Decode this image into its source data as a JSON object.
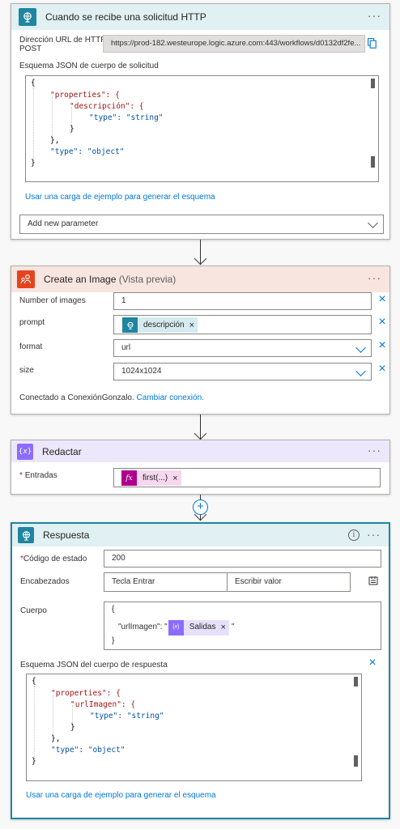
{
  "card1": {
    "title": "Cuando se recibe una solicitud HTTP",
    "more": "···",
    "url_label_1": "Dirección URL de HTTP",
    "url_label_2": "POST",
    "url_value": "https://prod-182.westeurope.logic.azure.com:443/workflows/d0132df2fe...",
    "schema_label": "Esquema JSON de cuerpo de solicitud",
    "schema_lines": [
      "{",
      "\"properties\": {",
      "\"descripción\": {",
      "\"type\": \"string\"",
      "}",
      "},",
      "\"type\": \"object\"",
      "}"
    ],
    "sample_link": "Usar una carga de ejemplo para generar el esquema",
    "add_param": "Add new parameter"
  },
  "card2": {
    "title": "Create an Image",
    "title_sub": "(Vista previa)",
    "more": "···",
    "fields": [
      {
        "label": "Number of images",
        "value": "1"
      },
      {
        "label": "prompt",
        "token": "descripción"
      },
      {
        "label": "format",
        "value": "url"
      },
      {
        "label": "size",
        "value": "1024x1024"
      }
    ],
    "connection_text": "Conectado a ConexiónGonzalo.",
    "connection_link": "Cambiar conexión."
  },
  "card3": {
    "title": "Redactar",
    "more": "···",
    "inputs_label": "Entradas",
    "token": "first(...)",
    "token_icon": "fx"
  },
  "card4": {
    "title": "Respuesta",
    "more": "···",
    "info": "i",
    "status_label": "Código de estado",
    "status_value": "200",
    "headers_label": "Encabezados",
    "header_key_placeholder": "Tecla Entrar",
    "header_value_placeholder": "Escribir valor",
    "body_label": "Cuerpo",
    "body_open": "{",
    "body_key": "\"urlImagen\": \"",
    "body_token": "Salidas",
    "body_end_quote": "\"",
    "body_close": "}",
    "schema_label": "Esquema JSON del cuerpo de respuesta",
    "schema_lines": [
      "{",
      "\"properties\": {",
      "\"urlImagen\": {",
      "\"type\": \"string\"",
      "}",
      "},",
      "\"type\": \"object\"",
      "}"
    ],
    "sample_link": "Usar una carga de ejemplo para generar el esquema"
  },
  "remove_icon": "×",
  "colors": {
    "http_teal": "#1f85a0",
    "openai_red": "#e5441e",
    "openai_header": "#f9e5e0",
    "compose_purple": "#8c6cff",
    "compose_header": "#ece7fb",
    "http_header": "#e0f0f3",
    "fx_magenta": "#ad008c",
    "token_pink": "#f6d8ee",
    "token_lilac": "#e7e0fb",
    "token_teal_bg": "#d6ebf0",
    "link_blue": "#0078d4"
  }
}
